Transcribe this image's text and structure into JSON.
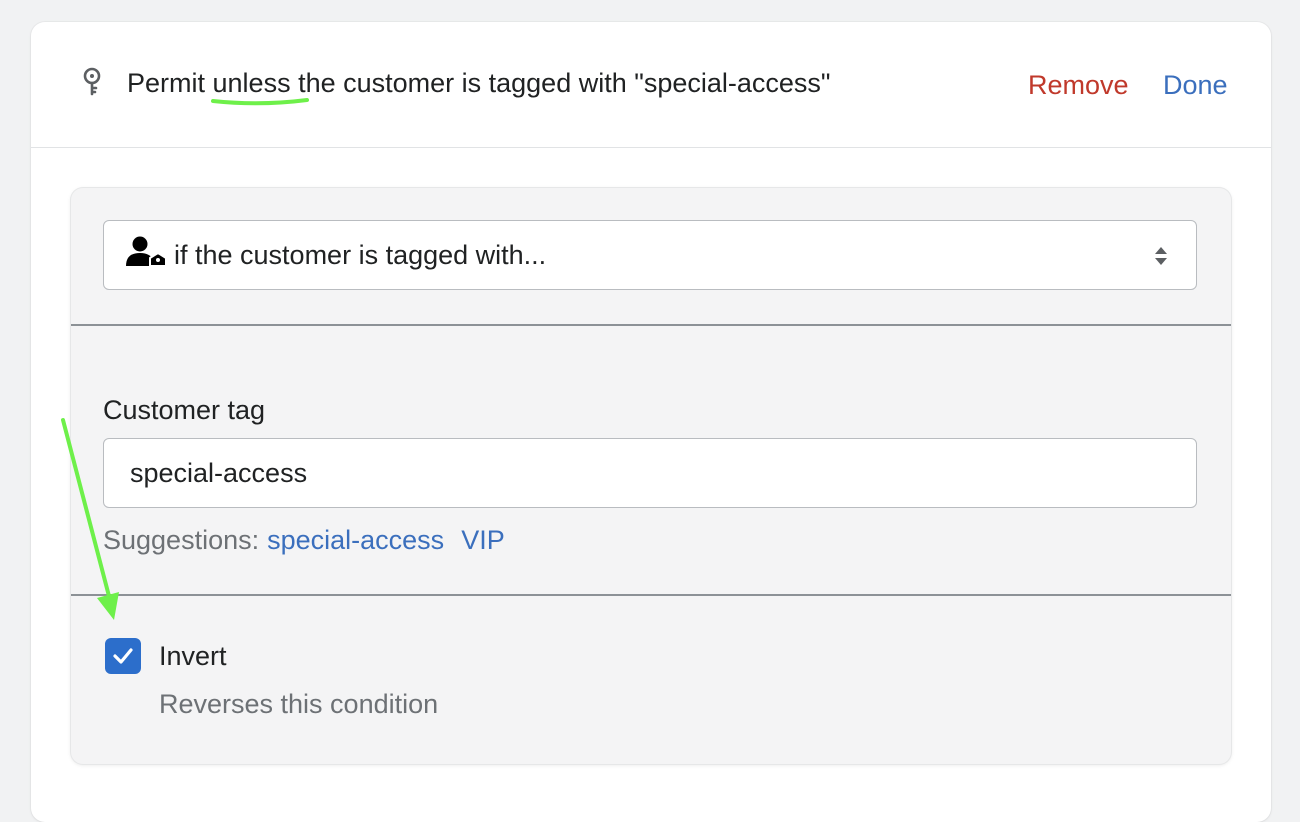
{
  "header": {
    "text_before": "Permit ",
    "text_keyword": "unless",
    "text_after": " the customer is tagged with \"special-access\"",
    "remove_label": "Remove",
    "done_label": "Done",
    "icon": "key-icon"
  },
  "condition": {
    "select_value": "if the customer is tagged with...",
    "select_icon": "customer-tag-icon"
  },
  "customer_tag_field": {
    "label": "Customer tag",
    "value": "special-access",
    "suggestions_label": "Suggestions:",
    "suggestions": [
      "special-access",
      "VIP"
    ]
  },
  "invert": {
    "checked": true,
    "label": "Invert",
    "help_text": "Reverses this condition"
  },
  "colors": {
    "remove": "#c0392b",
    "link": "#3b6fbd",
    "checkbox": "#2c6ecb",
    "annotation": "#6ef04a"
  }
}
